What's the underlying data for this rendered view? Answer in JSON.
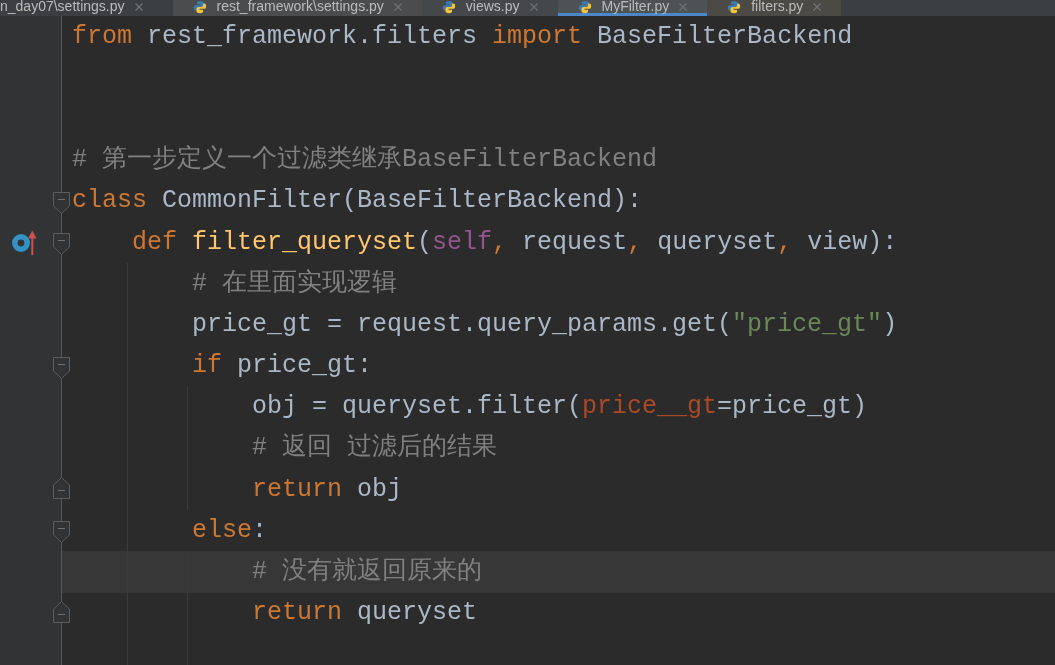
{
  "tabs": [
    {
      "label": "n_day07\\settings.py",
      "selected": false,
      "clipped": true,
      "color": "#3c3f41"
    },
    {
      "label": "rest_framework\\settings.py",
      "selected": false,
      "clipped": false,
      "color": "#4a4c4e"
    },
    {
      "label": "views.py",
      "selected": false,
      "clipped": false,
      "color": "#45484a"
    },
    {
      "label": "MyFilter.py",
      "selected": true,
      "clipped": false,
      "color": "#4e5254"
    },
    {
      "label": "filters.py",
      "selected": false,
      "clipped": false,
      "color": "#4b4a44"
    }
  ],
  "code": [
    {
      "kind": "code",
      "current": false,
      "override": false,
      "segments": [
        {
          "kind": "keyword",
          "text": "from"
        },
        {
          "kind": "plain",
          "text": " rest_framework.filters "
        },
        {
          "kind": "keyword",
          "text": "import"
        },
        {
          "kind": "plain",
          "text": " BaseFilterBackend"
        }
      ]
    },
    {
      "kind": "blank",
      "current": false,
      "override": false
    },
    {
      "kind": "blank",
      "current": false,
      "override": false
    },
    {
      "kind": "code",
      "current": false,
      "override": false,
      "segments": [
        {
          "kind": "comment",
          "text": "# 第一步定义一个过滤类继承BaseFilterBackend"
        }
      ]
    },
    {
      "kind": "code",
      "current": false,
      "override": false,
      "expanded": true,
      "segments": [
        {
          "kind": "keyword",
          "text": "class"
        },
        {
          "kind": "plain",
          "text": " CommonFilter(BaseFilterBackend):"
        }
      ],
      "children": [
        {
          "kind": "code",
          "current": false,
          "override": true,
          "expanded": true,
          "segments": [
            {
              "kind": "keyword",
              "text": "def "
            },
            {
              "kind": "function",
              "text": "filter_queryset"
            },
            {
              "kind": "plain",
              "text": "("
            },
            {
              "kind": "self",
              "text": "self"
            },
            {
              "kind": "keyword",
              "text": ","
            },
            {
              "kind": "plain",
              "text": " request"
            },
            {
              "kind": "keyword",
              "text": ","
            },
            {
              "kind": "plain",
              "text": " queryset"
            },
            {
              "kind": "keyword",
              "text": ","
            },
            {
              "kind": "plain",
              "text": " view):"
            }
          ],
          "children": [
            {
              "kind": "code",
              "current": false,
              "override": false,
              "segments": [
                {
                  "kind": "comment",
                  "text": "# 在里面实现逻辑"
                }
              ]
            },
            {
              "kind": "code",
              "current": false,
              "override": false,
              "segments": [
                {
                  "kind": "plain",
                  "text": "price_gt = request.query_params.get("
                },
                {
                  "kind": "string",
                  "text": "\"price_gt\""
                },
                {
                  "kind": "plain",
                  "text": ")"
                }
              ]
            },
            {
              "kind": "code",
              "current": false,
              "override": false,
              "expanded": true,
              "segments": [
                {
                  "kind": "keyword",
                  "text": "if"
                },
                {
                  "kind": "plain",
                  "text": " price_gt:"
                }
              ],
              "children": [
                {
                  "kind": "code",
                  "current": false,
                  "override": false,
                  "segments": [
                    {
                      "kind": "plain",
                      "text": "obj = queryset.filter("
                    },
                    {
                      "kind": "kwarg",
                      "text": "price__gt"
                    },
                    {
                      "kind": "plain",
                      "text": "=price_gt)"
                    }
                  ]
                },
                {
                  "kind": "code",
                  "current": false,
                  "override": false,
                  "segments": [
                    {
                      "kind": "comment",
                      "text": "# 返回 过滤后的结果"
                    }
                  ]
                },
                {
                  "kind": "code",
                  "current": false,
                  "override": false,
                  "segments": [
                    {
                      "kind": "keyword",
                      "text": "return"
                    },
                    {
                      "kind": "plain",
                      "text": " obj"
                    }
                  ]
                }
              ]
            },
            {
              "kind": "code",
              "current": false,
              "override": false,
              "expanded": true,
              "segments": [
                {
                  "kind": "keyword",
                  "text": "else"
                },
                {
                  "kind": "plain",
                  "text": ":"
                }
              ],
              "children": [
                {
                  "kind": "code",
                  "current": true,
                  "override": false,
                  "segments": [
                    {
                      "kind": "comment",
                      "text": "# 没有就返回原来的"
                    }
                  ]
                },
                {
                  "kind": "code",
                  "current": false,
                  "override": false,
                  "segments": [
                    {
                      "kind": "keyword",
                      "text": "return"
                    },
                    {
                      "kind": "plain",
                      "text": " queryset"
                    }
                  ]
                }
              ]
            }
          ]
        }
      ]
    }
  ]
}
